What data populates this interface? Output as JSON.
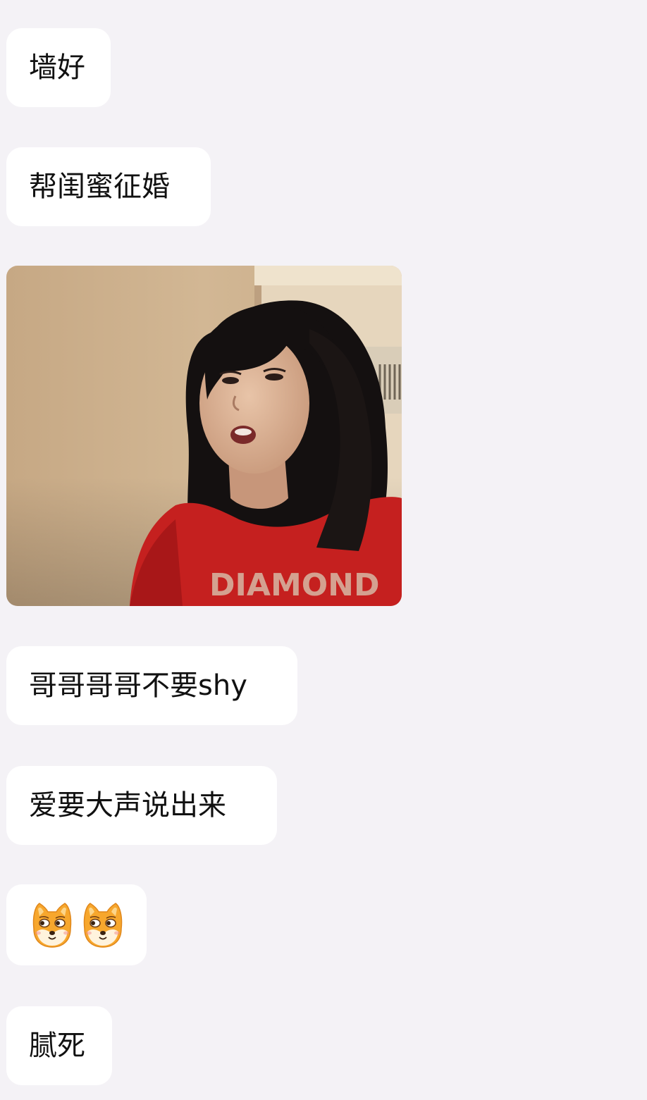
{
  "messages": [
    {
      "type": "text",
      "text": "墙好"
    },
    {
      "type": "text",
      "text": "帮闺蜜征婚"
    },
    {
      "type": "image",
      "shirt_text": "DIAMOND"
    },
    {
      "type": "text",
      "text": "哥哥哥哥不要shy"
    },
    {
      "type": "text",
      "text": "爱要大声说出来"
    },
    {
      "type": "emoji",
      "icons": [
        "shiba-dog-emoji",
        "shiba-dog-emoji"
      ]
    },
    {
      "type": "text",
      "text": "腻死"
    }
  ],
  "colors": {
    "background": "#f4f2f6",
    "bubble": "#ffffff",
    "text": "#111111"
  }
}
